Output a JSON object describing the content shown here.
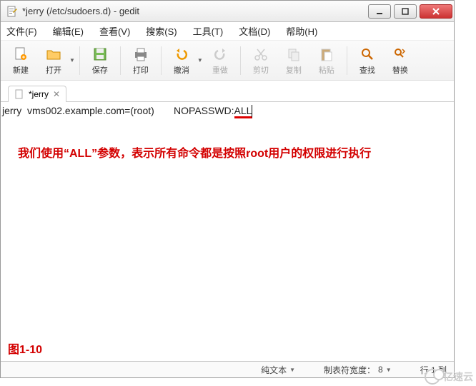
{
  "title": "*jerry (/etc/sudoers.d) - gedit",
  "menus": {
    "file": "文件(F)",
    "edit": "编辑(E)",
    "view": "查看(V)",
    "search": "搜索(S)",
    "tools": "工具(T)",
    "doc": "文档(D)",
    "help": "帮助(H)"
  },
  "toolbar": {
    "new": "新建",
    "open": "打开",
    "save": "保存",
    "print": "打印",
    "undo": "撤消",
    "redo": "重做",
    "cut": "剪切",
    "copy": "复制",
    "paste": "粘贴",
    "find": "查找",
    "replace": "替换"
  },
  "tab": {
    "name": "*jerry"
  },
  "editor": {
    "pre": "jerry  vms002.example.com=(root)       NOPASSWD:",
    "all": "ALL"
  },
  "annotation1": "我们使用“ALL”参数，表示所有命令都是按照root用户的权限进行执行",
  "annotation2": "图1-10",
  "status": {
    "filetype": "纯文本",
    "tabwidth_label": "制表符宽度：",
    "tabwidth_value": "8",
    "pos": "行 1,列"
  },
  "watermark": "亿速云"
}
